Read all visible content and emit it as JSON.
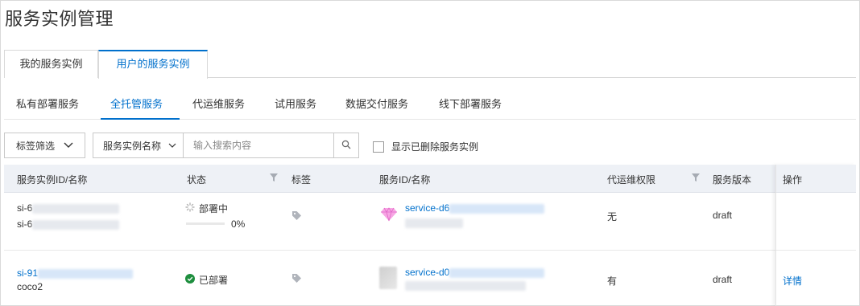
{
  "page": {
    "title": "服务实例管理"
  },
  "primary_tabs": [
    {
      "label": "我的服务实例",
      "active": false
    },
    {
      "label": "用户的服务实例",
      "active": true
    }
  ],
  "secondary_tabs": [
    {
      "label": "私有部署服务",
      "active": false
    },
    {
      "label": "全托管服务",
      "active": true
    },
    {
      "label": "代运维服务",
      "active": false
    },
    {
      "label": "试用服务",
      "active": false
    },
    {
      "label": "数据交付服务",
      "active": false
    },
    {
      "label": "线下部署服务",
      "active": false
    }
  ],
  "filters": {
    "tag_filter_label": "标签筛选",
    "search_field_selected": "服务实例名称",
    "search_placeholder": "输入搜索内容",
    "show_deleted_label": "显示已删除服务实例",
    "show_deleted_checked": false
  },
  "table": {
    "columns": [
      "服务实例ID/名称",
      "状态",
      "标签",
      "服务ID/名称",
      "代运维权限",
      "服务版本",
      "操作"
    ],
    "rows": [
      {
        "instance_id": "si-6",
        "instance_name": "si-6",
        "status": "部署中",
        "status_icon": "spinner-icon",
        "progress": "0%",
        "progress_value": 0,
        "service_id": "service-d6",
        "service_icon": "diamond-icon",
        "ops_permission": "无",
        "version": "draft",
        "action": ""
      },
      {
        "instance_id": "si-91",
        "instance_name": "coco2",
        "status": "已部署",
        "status_icon": "check-circle-icon",
        "service_id": "service-d0",
        "ops_permission": "有",
        "version": "draft",
        "action": "详情"
      }
    ]
  },
  "colors": {
    "accent": "#0070cc",
    "success": "#1e8e3e",
    "header_bg": "#eef1f6",
    "diamond": "#f07ad6"
  }
}
